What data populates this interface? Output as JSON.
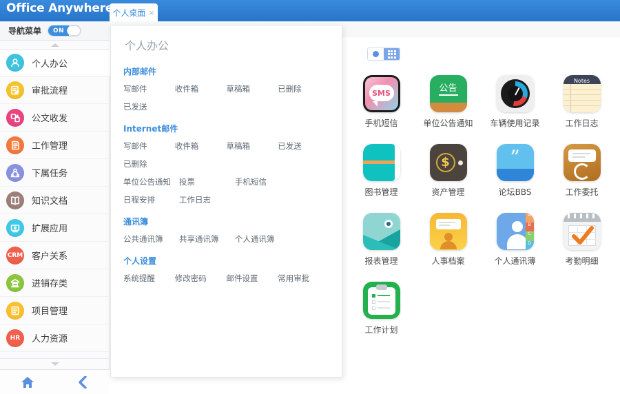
{
  "topbar": {
    "logo": "Office Anywhere",
    "logo_mark": "®",
    "tab_label": "个人桌面",
    "tab_close": "×",
    "brand_color": "#2e7dd1"
  },
  "sidebar": {
    "nav_toggle": {
      "label": "导航菜单",
      "state": "ON",
      "on_color": "#3c8ede"
    },
    "scroll_up_icon": "caret-up-icon",
    "scroll_down_icon": "caret-down-icon",
    "items": [
      {
        "label": "个人办公",
        "icon": "person-icon",
        "color": "#3fc4e0",
        "active": true
      },
      {
        "label": "审批流程",
        "icon": "approval-icon",
        "color": "#f5c32c",
        "active": false
      },
      {
        "label": "公文收发",
        "icon": "document-icon",
        "color": "#e8457f",
        "active": false
      },
      {
        "label": "工作管理",
        "icon": "tasks-icon",
        "color": "#f5783c",
        "active": false
      },
      {
        "label": "下属任务",
        "icon": "team-icon",
        "color": "#8a92e0",
        "active": false
      },
      {
        "label": "知识文档",
        "icon": "book-icon",
        "color": "#9b8179",
        "active": false
      },
      {
        "label": "扩展应用",
        "icon": "apps-icon",
        "color": "#40c8e8",
        "active": false
      },
      {
        "label": "客户关系",
        "icon": "crm-icon",
        "color": "#f0604d",
        "active": false,
        "text": "CRM"
      },
      {
        "label": "进销存类",
        "icon": "inventory-icon",
        "color": "#8cc63f",
        "active": false
      },
      {
        "label": "项目管理",
        "icon": "project-icon",
        "color": "#fbc02d",
        "active": false
      },
      {
        "label": "人力资源",
        "icon": "hr-icon",
        "color": "#f0604d",
        "active": false,
        "text": "HR"
      }
    ],
    "footer": {
      "home_icon": "home-icon",
      "back_icon": "chevron-left-icon"
    }
  },
  "panel": {
    "title": "个人办公",
    "groups": [
      {
        "heading": "内部邮件",
        "rows": [
          [
            "写邮件",
            "收件箱",
            "草稿箱",
            "已删除"
          ],
          [
            "已发送"
          ]
        ]
      },
      {
        "heading": "Internet邮件",
        "rows": [
          [
            "写邮件",
            "收件箱",
            "草稿箱",
            "已发送"
          ],
          [
            "已删除"
          ],
          [
            "单位公告通知",
            "投票",
            "手机短信"
          ],
          [
            "日程安排",
            "工作日志"
          ]
        ]
      },
      {
        "heading": "通讯簿",
        "rows": [
          [
            "公共通讯簿",
            "共享通讯簿",
            "个人通讯簿"
          ]
        ]
      },
      {
        "heading": "个人设置",
        "rows": [
          [
            "系统提醒",
            "修改密码",
            "邮件设置",
            "常用审批"
          ]
        ]
      }
    ]
  },
  "content": {
    "view_toggle": {
      "list_icon": "circle-view-icon",
      "grid_icon": "grid-view-icon",
      "active": "grid"
    },
    "apps": [
      {
        "label": "手机短信",
        "icon": "sms-icon",
        "color": "#f06292"
      },
      {
        "label": "单位公告通知",
        "icon": "announce-icon",
        "color": "#2eb872"
      },
      {
        "label": "车辆使用记录",
        "icon": "gauge-icon",
        "color": "#2b2b2b"
      },
      {
        "label": "工作日志",
        "icon": "notes-icon",
        "color": "#f7eccb"
      },
      {
        "label": "图书管理",
        "icon": "book-app-icon",
        "color": "#0fc0c0"
      },
      {
        "label": "资产管理",
        "icon": "wallet-icon",
        "color": "#4d443c"
      },
      {
        "label": "论坛BBS",
        "icon": "quote-icon",
        "color": "#5bbcea"
      },
      {
        "label": "工作委托",
        "icon": "delegate-icon",
        "color": "#c07d2c"
      },
      {
        "label": "报表管理",
        "icon": "report-icon",
        "color": "#1aa6a6"
      },
      {
        "label": "人事档案",
        "icon": "personnel-icon",
        "color": "#fbbf24"
      },
      {
        "label": "个人通讯薄",
        "icon": "contacts-icon",
        "color": "#6fa8e8"
      },
      {
        "label": "考勤明细",
        "icon": "attendance-icon",
        "color": "#e0e3e6"
      },
      {
        "label": "工作计划",
        "icon": "plan-icon",
        "color": "#22b14c"
      }
    ]
  }
}
